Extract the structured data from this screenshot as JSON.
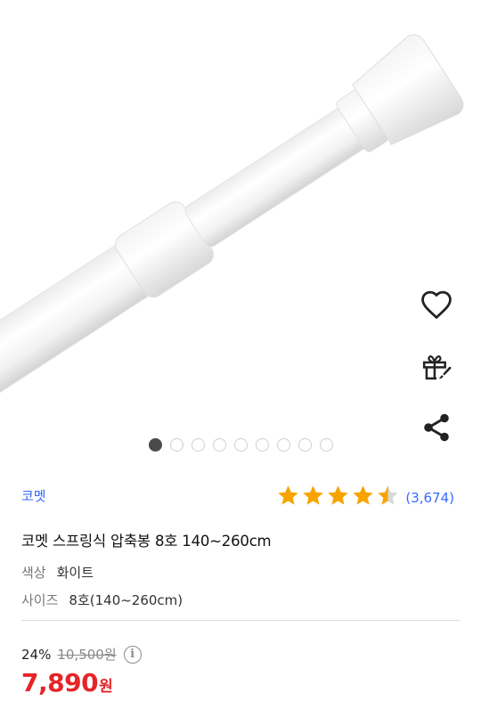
{
  "product": {
    "image_alt": "스프링식 압축봉 제품 이미지",
    "image_count": 9,
    "active_image": 0
  },
  "actions": {
    "wishlist_icon": "heart-icon",
    "gift_icon": "gift-icon",
    "share_icon": "share-icon"
  },
  "brand": "코멧",
  "rating": {
    "stars": 4.5,
    "count_text": "(3,674)",
    "star_color": "#f7a400"
  },
  "title": "코멧 스프링식 압축봉 8호 140~260cm",
  "options": [
    {
      "label": "색상",
      "value": "화이트"
    },
    {
      "label": "사이즈",
      "value": "8호(140~260cm)"
    }
  ],
  "pricing": {
    "discount_rate": "24%",
    "original_price": "10,500원",
    "sale_price": "7,890",
    "currency": "원",
    "price_color": "#e52528",
    "info_icon": "info-icon"
  }
}
